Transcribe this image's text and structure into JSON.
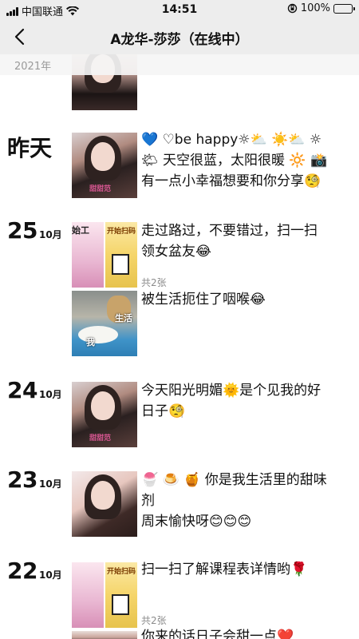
{
  "status_bar": {
    "carrier": "中国联通",
    "time": "14:51",
    "battery": "100%"
  },
  "nav": {
    "title": "A龙华-莎莎（在线中）"
  },
  "feed": {
    "year_label": "2021年",
    "yesterday_label": "昨天",
    "posts": [
      {
        "day": "",
        "month": "",
        "text": ""
      },
      {
        "day_label": "昨天",
        "line1": "💙 ♡be happy☼⛅ ☀️⛅ ☼",
        "line2": "🌤 天空很蓝，太阳很暖 🔆 📸",
        "line3": "有一点小幸福想要和你分享🧐",
        "thumb_tag": "甜甜范"
      },
      {
        "day": "25",
        "month": "10月",
        "line1": "走过路过，不要错过，扫一扫",
        "line2": "领女盆友😂",
        "image_count": "共2张",
        "poster_text": "开始扫码",
        "cartoon_text": "始工"
      },
      {
        "text": "被生活扼住了咽喉😂",
        "dog_label": "生活",
        "duck_label": "我"
      },
      {
        "day": "24",
        "month": "10月",
        "line1": "今天阳光明媚🌞是个见我的好",
        "line2": "日子🧐",
        "thumb_tag": "甜甜范"
      },
      {
        "day": "23",
        "month": "10月",
        "line1": "🍧 🍮 🍯 你是我生活里的甜味",
        "line2": "剂",
        "line3": "周末愉快呀😊😊😊"
      },
      {
        "day": "22",
        "month": "10月",
        "line1": "扫一扫了解课程表详情哟🌹",
        "image_count": "共2张",
        "poster_text": "开始扫码"
      },
      {
        "line1": "你来的话日子会甜一点❤️"
      }
    ]
  }
}
